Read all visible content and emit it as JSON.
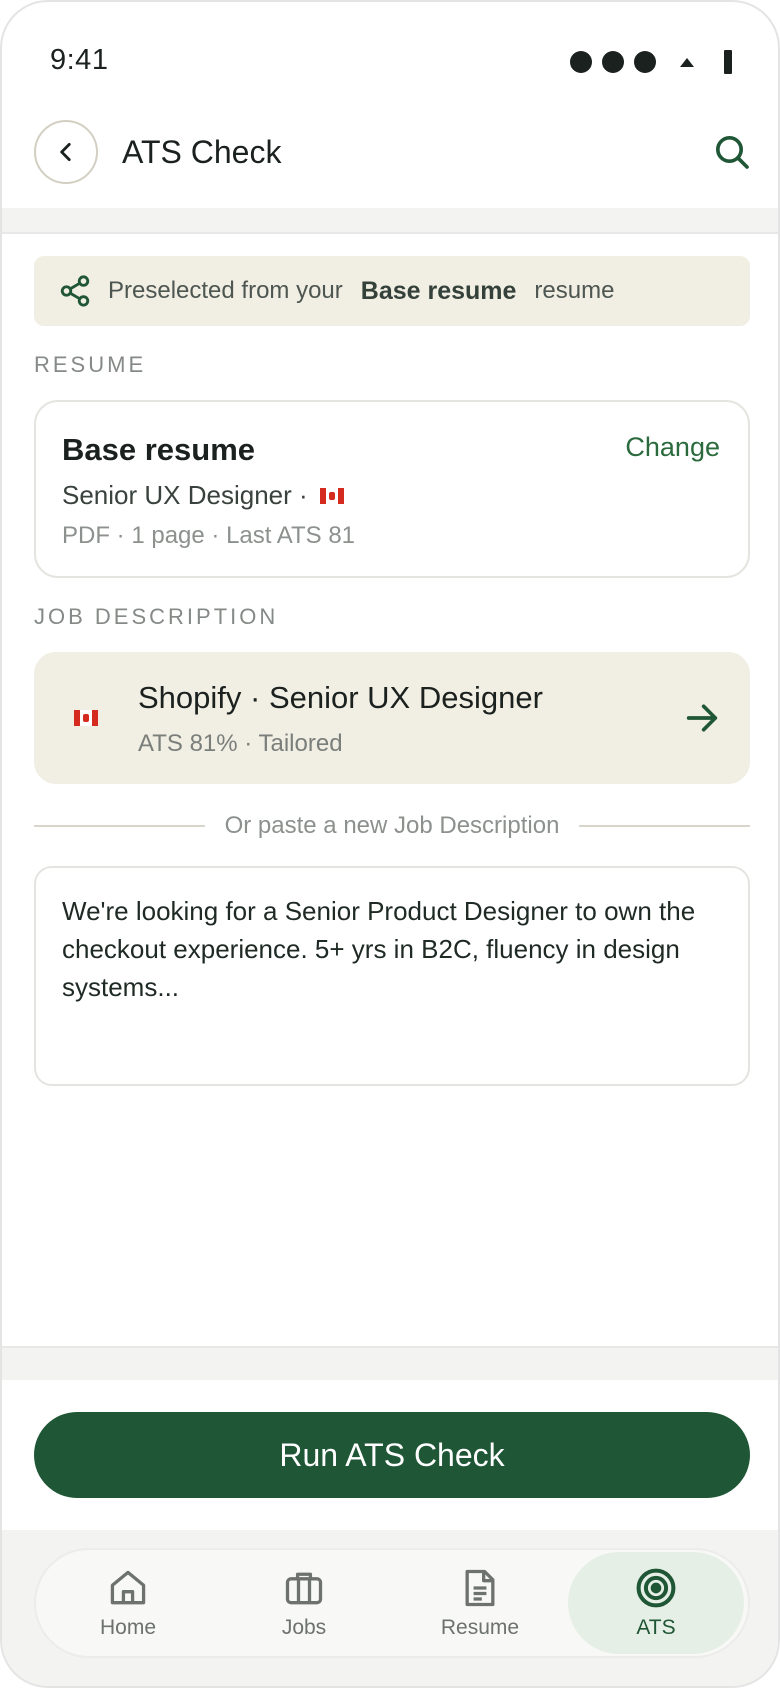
{
  "status_bar": {
    "time": "9:41"
  },
  "header": {
    "title": "ATS Check"
  },
  "banner": {
    "prefix": "Preselected from your",
    "resume_name": "Base resume",
    "suffix": "resume"
  },
  "resume_section": {
    "label": "RESUME",
    "name": "Base resume",
    "change_label": "Change",
    "role": "Senior UX Designer ·",
    "meta": "PDF · 1 page · Last ATS 81"
  },
  "job_section": {
    "label": "JOB DESCRIPTION",
    "title": "Shopify · Senior UX Designer",
    "subtitle": "ATS 81% · Tailored"
  },
  "paste": {
    "divider_text": "Or paste a new Job Description",
    "value": "We're looking for a Senior Product Designer to own the checkout experience. 5+ yrs in B2C, fluency in design systems..."
  },
  "run_button": {
    "label": "Run ATS Check"
  },
  "nav": {
    "items": [
      {
        "label": "Home",
        "icon": "home-icon"
      },
      {
        "label": "Jobs",
        "icon": "briefcase-icon"
      },
      {
        "label": "Resume",
        "icon": "document-icon"
      },
      {
        "label": "ATS",
        "icon": "target-icon",
        "active": true
      }
    ]
  },
  "colors": {
    "accent": "#1f5635",
    "accent_text": "#2b6a3c",
    "beige": "#f1eee3",
    "active_nav_bg": "#e6efe5"
  }
}
